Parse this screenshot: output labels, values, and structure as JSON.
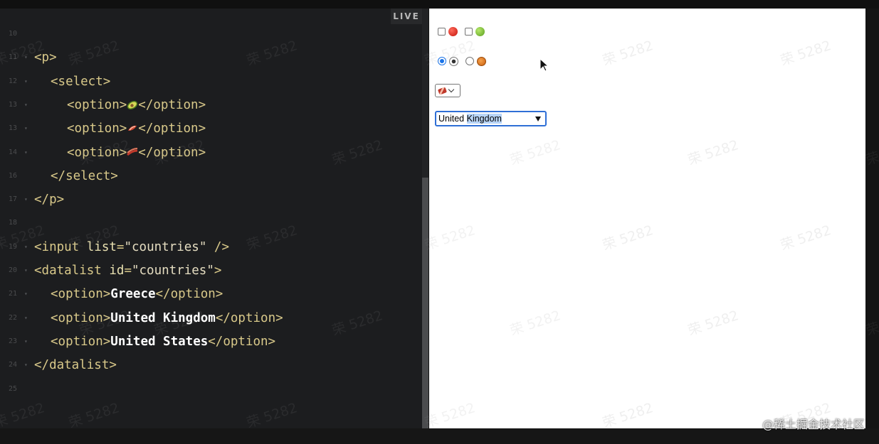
{
  "live_badge": "LIVE",
  "editor": {
    "lines": [
      {
        "num": "10",
        "fold": false,
        "parts": []
      },
      {
        "num": "11",
        "fold": true,
        "parts": [
          {
            "t": "tag",
            "v": "<p>"
          }
        ]
      },
      {
        "num": "12",
        "fold": true,
        "indent": 1,
        "parts": [
          {
            "t": "tag",
            "v": "<select>"
          }
        ]
      },
      {
        "num": "13",
        "fold": true,
        "indent": 2,
        "parts": [
          {
            "t": "tag",
            "v": "<option>"
          },
          {
            "t": "emoji",
            "v": "avocado"
          },
          {
            "t": "tag",
            "v": "</option>"
          }
        ]
      },
      {
        "num": "13",
        "fold": true,
        "indent": 2,
        "parts": [
          {
            "t": "tag",
            "v": "<option>"
          },
          {
            "t": "emoji",
            "v": "bacon"
          },
          {
            "t": "tag",
            "v": "</option>"
          }
        ]
      },
      {
        "num": "14",
        "fold": true,
        "indent": 2,
        "parts": [
          {
            "t": "tag",
            "v": "<option>"
          },
          {
            "t": "emoji",
            "v": "bacon-strips"
          },
          {
            "t": "tag",
            "v": "</option>"
          }
        ]
      },
      {
        "num": "16",
        "fold": false,
        "indent": 1,
        "parts": [
          {
            "t": "tag",
            "v": "</select>"
          }
        ]
      },
      {
        "num": "17",
        "fold": true,
        "parts": [
          {
            "t": "tag",
            "v": "</p>"
          }
        ]
      },
      {
        "num": "18",
        "fold": false,
        "parts": []
      },
      {
        "num": "19",
        "fold": true,
        "parts": [
          {
            "t": "tag",
            "v": "<input "
          },
          {
            "t": "attr",
            "v": "list"
          },
          {
            "t": "punct",
            "v": "="
          },
          {
            "t": "str",
            "v": "\"countries\""
          },
          {
            "t": "tag",
            "v": " />"
          }
        ]
      },
      {
        "num": "20",
        "fold": true,
        "parts": [
          {
            "t": "tag",
            "v": "<datalist "
          },
          {
            "t": "attr",
            "v": "id"
          },
          {
            "t": "punct",
            "v": "="
          },
          {
            "t": "str",
            "v": "\"countries\""
          },
          {
            "t": "tag",
            "v": ">"
          }
        ]
      },
      {
        "num": "21",
        "fold": true,
        "indent": 1,
        "parts": [
          {
            "t": "tag",
            "v": "<option>"
          },
          {
            "t": "txt",
            "v": "Greece"
          },
          {
            "t": "tag",
            "v": "</option>"
          }
        ]
      },
      {
        "num": "22",
        "fold": true,
        "indent": 1,
        "parts": [
          {
            "t": "tag",
            "v": "<option>"
          },
          {
            "t": "txt",
            "v": "United Kingdom"
          },
          {
            "t": "tag",
            "v": "</option>"
          }
        ]
      },
      {
        "num": "23",
        "fold": true,
        "indent": 1,
        "parts": [
          {
            "t": "tag",
            "v": "<option>"
          },
          {
            "t": "txt",
            "v": "United States"
          },
          {
            "t": "tag",
            "v": "</option>"
          }
        ]
      },
      {
        "num": "24",
        "fold": true,
        "parts": [
          {
            "t": "tag",
            "v": "</datalist>"
          }
        ]
      },
      {
        "num": "25",
        "fold": false,
        "parts": []
      }
    ]
  },
  "preview": {
    "checkboxes": [
      {
        "icon": "red-apple-icon",
        "checked": false
      },
      {
        "icon": "green-apple-icon",
        "checked": false
      }
    ],
    "radios": [
      {
        "icon": "soccer-ball-icon",
        "checked": true
      },
      {
        "icon": "basketball-icon",
        "checked": false
      }
    ],
    "emoji_select": {
      "selected_icon": "bacon-icon"
    },
    "country_input": {
      "value_prefix": "United ",
      "value_selected": "Kingdom"
    }
  },
  "watermark_text": "荣 5282",
  "credit": "@稀土掘金技术社区"
}
